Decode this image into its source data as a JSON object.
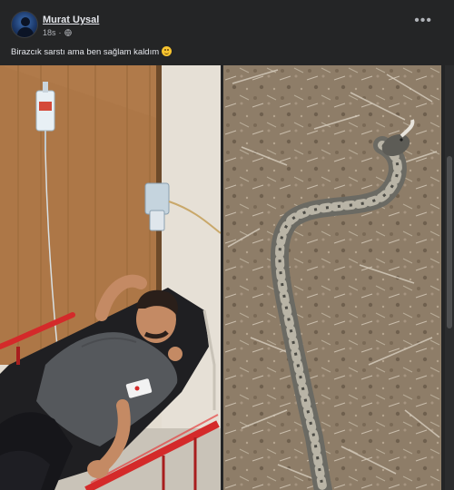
{
  "post": {
    "author": "Murat Uysal",
    "time": "18s",
    "caption": "Birazcık sarstı ama ben sağlam kaldım",
    "emoji": "smiling-face-emoji",
    "more_label": "•••"
  },
  "photos": [
    {
      "name": "hospital-photo"
    },
    {
      "name": "snake-photo"
    }
  ],
  "colors": {
    "background": "#242526",
    "text": "#e4e6eb",
    "muted": "#b0b3b8",
    "stretcher_red": "#d42a2a"
  }
}
